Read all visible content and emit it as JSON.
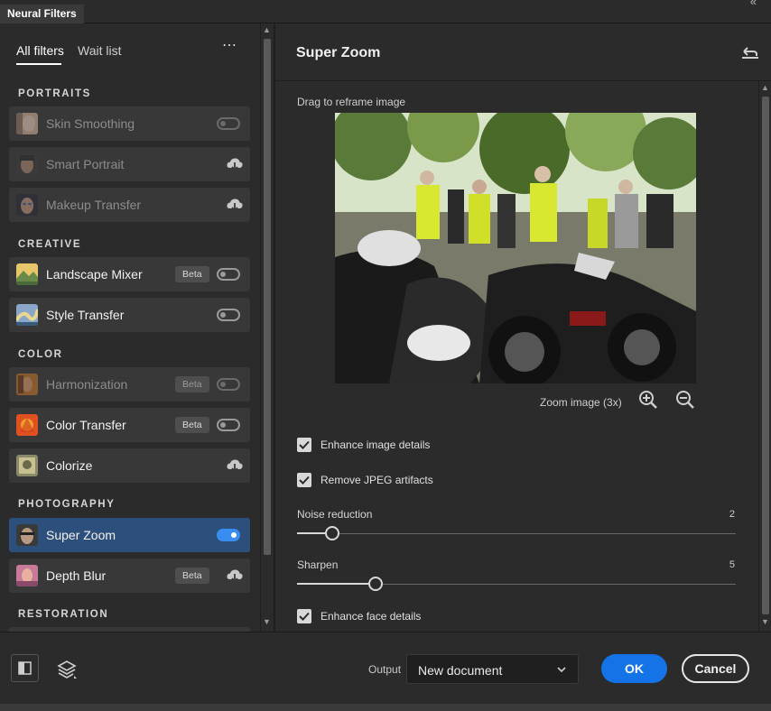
{
  "window": {
    "title": "Neural Filters"
  },
  "tabs": [
    {
      "label": "All filters",
      "active": true
    },
    {
      "label": "Wait list",
      "active": false
    }
  ],
  "more_label": "⋯",
  "sections": {
    "portraits": "PORTRAITS",
    "creative": "CREATIVE",
    "color": "COLOR",
    "photography": "PHOTOGRAPHY",
    "restoration": "RESTORATION"
  },
  "filters": {
    "skin_smoothing": {
      "label": "Skin Smoothing",
      "control": "toggle-off",
      "disabled": true
    },
    "smart_portrait": {
      "label": "Smart Portrait",
      "control": "cloud-download",
      "disabled": true
    },
    "makeup_transfer": {
      "label": "Makeup Transfer",
      "control": "cloud-download",
      "disabled": true
    },
    "landscape_mixer": {
      "label": "Landscape Mixer",
      "badge": "Beta",
      "control": "toggle-off"
    },
    "style_transfer": {
      "label": "Style Transfer",
      "control": "toggle-off"
    },
    "harmonization": {
      "label": "Harmonization",
      "badge": "Beta",
      "control": "toggle-off",
      "disabled": true
    },
    "color_transfer": {
      "label": "Color Transfer",
      "badge": "Beta",
      "control": "toggle-off"
    },
    "colorize": {
      "label": "Colorize",
      "control": "cloud-download"
    },
    "super_zoom": {
      "label": "Super Zoom",
      "control": "toggle-on",
      "selected": true
    },
    "depth_blur": {
      "label": "Depth Blur",
      "badge": "Beta",
      "control": "cloud-download"
    }
  },
  "panel": {
    "title": "Super Zoom",
    "drag_label": "Drag to reframe image",
    "zoom_label": "Zoom image (3x)",
    "checkboxes": [
      {
        "label": "Enhance image details",
        "checked": true
      },
      {
        "label": "Remove JPEG artifacts",
        "checked": true
      },
      {
        "label": "Enhance face details",
        "checked": true
      }
    ],
    "sliders": {
      "noise": {
        "label": "Noise reduction",
        "value": "2",
        "fraction": 0.08
      },
      "sharpen": {
        "label": "Sharpen",
        "value": "5",
        "fraction": 0.18
      }
    }
  },
  "footer": {
    "output_label": "Output",
    "output_value": "New document",
    "ok_label": "OK",
    "cancel_label": "Cancel"
  },
  "colors": {
    "accent": "#1473e6",
    "toggle_on": "#378ef0",
    "selected_row": "#2c4f7c",
    "panel_bg": "#2b2b2b"
  },
  "icons": [
    "collapse-icon",
    "more-icon",
    "cloud-download-icon",
    "reset-icon",
    "zoom-in-icon",
    "zoom-out-icon",
    "compare-icon",
    "layers-icon",
    "chevron-down-icon",
    "checkmark-icon"
  ]
}
